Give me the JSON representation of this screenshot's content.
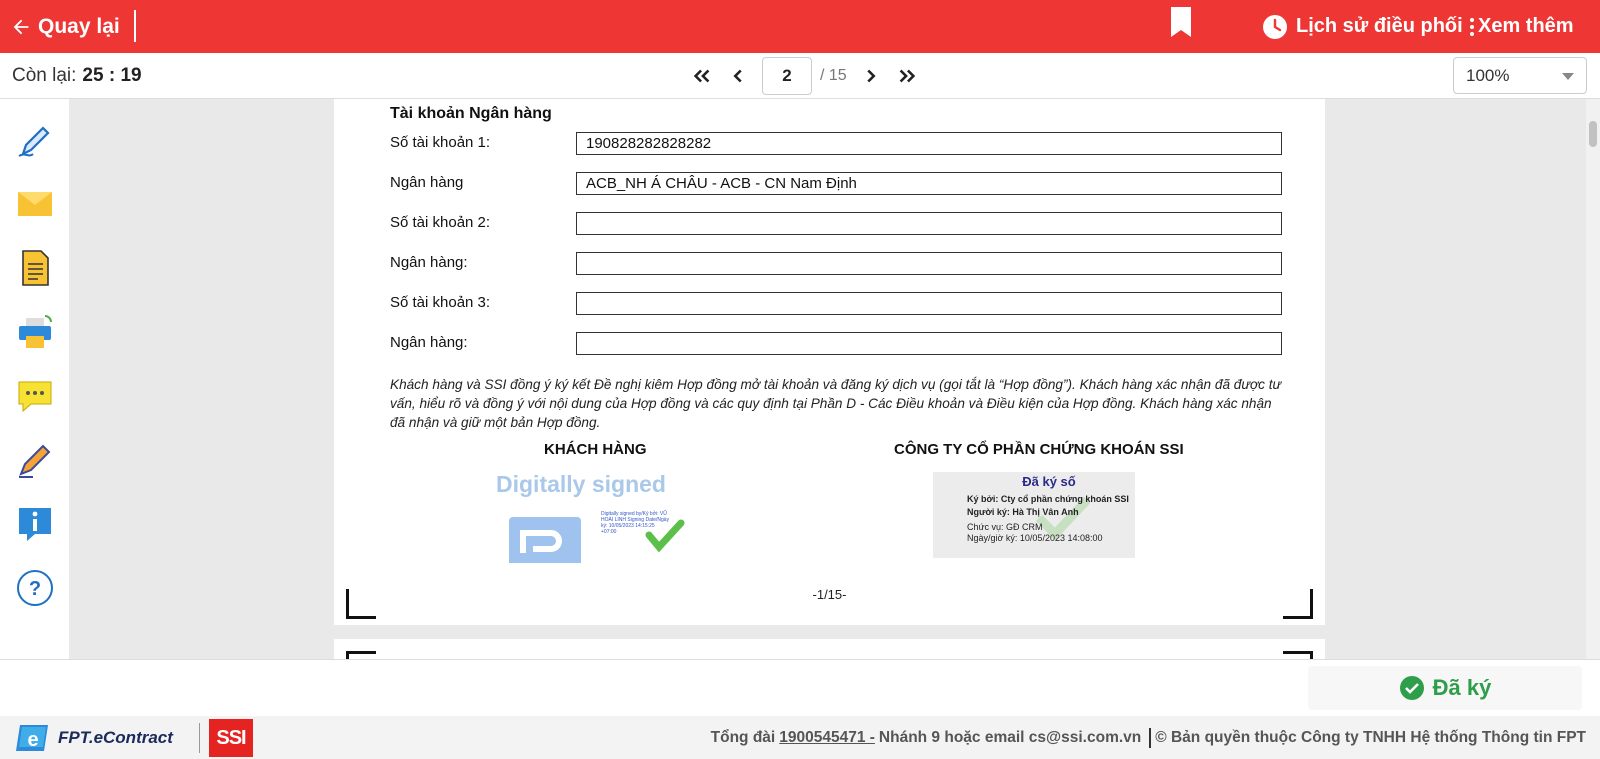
{
  "header": {
    "back_label": "Quay lại",
    "history_label": "Lịch sử điều phối",
    "more_label": "Xem thêm",
    "brand_color": "#ee3634"
  },
  "toolbar": {
    "timer_label": "Còn lại:",
    "timer_value": "25 : 19",
    "current_page": "2",
    "total_pages": "/ 15",
    "zoom": "100%"
  },
  "sidebar": {
    "icons": [
      "sign-pen-icon",
      "mail-icon",
      "document-icon",
      "printer-icon",
      "chat-icon",
      "highlighter-icon",
      "info-icon",
      "help-icon"
    ]
  },
  "document": {
    "section_title": "Tài khoản Ngân hàng",
    "fields": [
      {
        "label": "Số tài khoản 1:",
        "value": "190828282828282"
      },
      {
        "label": "Ngân hàng",
        "value": "ACB_NH Á CHÂU - ACB - CN Nam Định"
      },
      {
        "label": "Số tài khoản 2:",
        "value": ""
      },
      {
        "label": "Ngân hàng:",
        "value": ""
      },
      {
        "label": "Số tài khoản 3:",
        "value": ""
      },
      {
        "label": "Ngân hàng:",
        "value": ""
      }
    ],
    "consent_text": "Khách hàng và SSI đồng ý ký kết Đề nghị kiêm Hợp đồng mở tài khoản và đăng ký dịch vụ (gọi tắt là “Hợp đồng”). Khách hàng xác nhận đã được tư vấn, hiểu rõ và đồng ý với nội dung của Hợp đồng và các quy định tại Phần D - Các Điều khoản và Điều kiện của Hợp đồng. Khách hàng xác nhận đã nhận và giữ một bản Hợp đồng.",
    "customer_heading": "KHÁCH HÀNG",
    "company_heading": "CÔNG TY CỔ PHẦN CHỨNG KHOÁN SSI",
    "digital_signed_text": "Digitally signed",
    "digital_signed_mini": "Digitally signed by/Ký bởi: VŨ HOÀI LINH Signing Date/Ngày ký: 10/05/2023 14:15:25 +07:00",
    "stamp": {
      "title": "Đã ký số",
      "signed_by": "Ký bởi: Cty cổ phần chứng khoán SSI",
      "signer": "Người ký: Hà Thị Vân Anh",
      "position": "Chức vụ: GĐ CRM",
      "datetime": "Ngày/giờ ký: 10/05/2023 14:08:00"
    },
    "page_number": "-1/15-"
  },
  "actions": {
    "signed_label": "Đã ký",
    "signed_color": "#2e9e4a"
  },
  "footer": {
    "brand": "FPT.eContract",
    "partner": "SSI",
    "hotline_prefix": "Tổng đài",
    "hotline": "1900545471 -",
    "hotline_suffix": "Nhánh 9 hoặc email cs@ssi.com.vn",
    "copyright": "© Bản quyền thuộc Công ty TNHH Hệ thống Thông tin FPT"
  }
}
